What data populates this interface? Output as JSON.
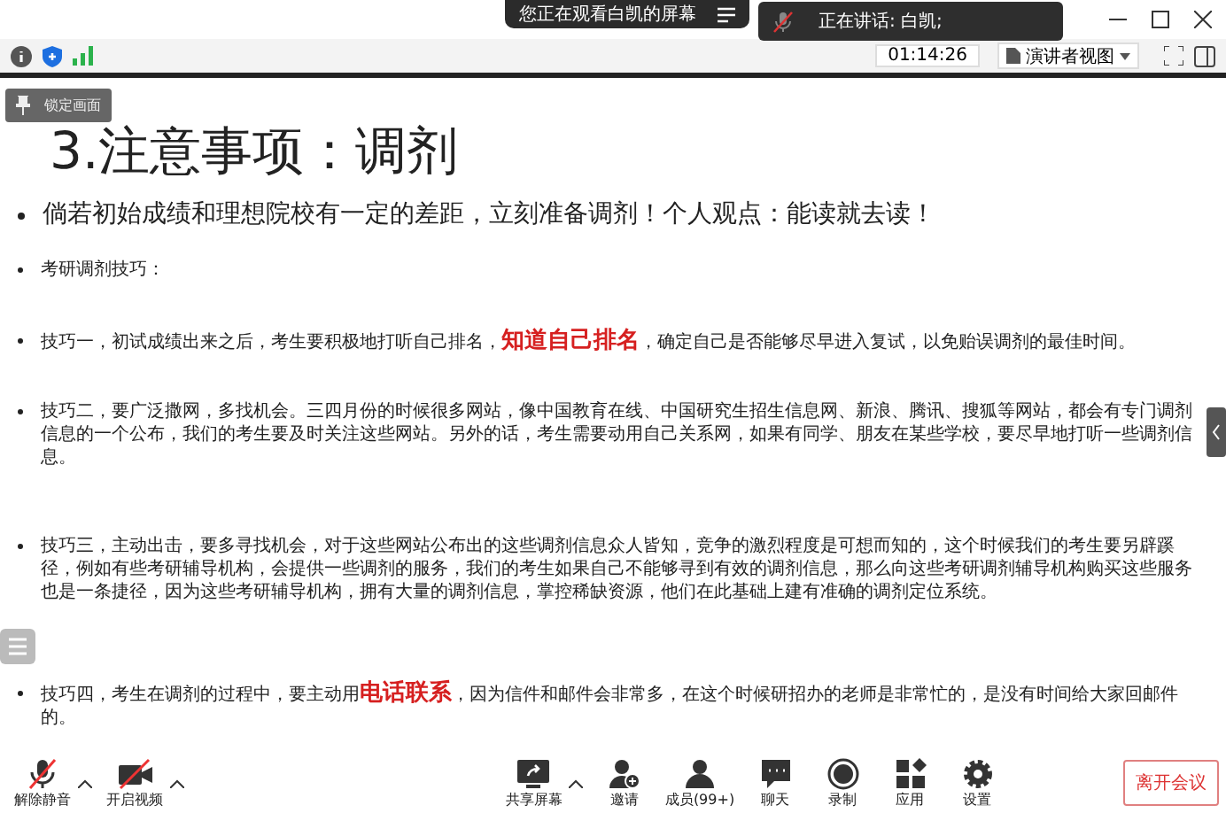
{
  "banner": {
    "text": "您正在观看白凯的屏幕"
  },
  "speaking": {
    "text": "正在讲话: 白凯;"
  },
  "toolbar": {
    "time": "01:14:26",
    "view_menu": "演讲者视图"
  },
  "lock_button": "锁定画面",
  "slide": {
    "title": "3.注意事项：调剂",
    "lead": "倘若初始成绩和理想院校有一定的差距，立刻准备调剂！个人观点：能读就去读！",
    "items": [
      [
        {
          "kind": "plain",
          "text": "考研调剂技巧："
        }
      ],
      [
        {
          "kind": "plain",
          "text": "技巧一，初试成绩出来之后，考生要积极地打听自己排名，"
        },
        {
          "kind": "highlight",
          "text": "知道自己排名"
        },
        {
          "kind": "plain",
          "text": "，确定自己是否能够尽早进入复试，以免贻误调剂的最佳时间。"
        }
      ],
      [
        {
          "kind": "plain",
          "text": "技巧二，要广泛撒网，多找机会。三四月份的时候很多网站，像中国教育在线、中国研究生招生信息网、新浪、腾讯、搜狐等网站，都会有专门调剂信息的一个公布，我们的考生要及时关注这些网站。另外的话，考生需要动用自己关系网，如果有同学、朋友在某些学校，要尽早地打听一些调剂信息。"
        }
      ],
      [
        {
          "kind": "plain",
          "text": "技巧三，主动出击，要多寻找机会，对于这些网站公布出的这些调剂信息众人皆知，竞争的激烈程度是可想而知的，这个时候我们的考生要另辟蹊径，例如有些考研辅导机构，会提供一些调剂的服务，我们的考生如果自己不能够寻到有效的调剂信息，那么向这些考研调剂辅导机构购买这些服务也是一条捷径，因为这些考研辅导机构，拥有大量的调剂信息，掌控稀缺资源，他们在此基础上建有准确的调剂定位系统。"
        }
      ],
      [
        {
          "kind": "plain",
          "text": "技巧四，考生在调剂的过程中，要主动用"
        },
        {
          "kind": "highlight",
          "text": "电话联系"
        },
        {
          "kind": "plain",
          "text": "，因为信件和邮件会非常多，在这个时候研招办的老师是非常忙的，是没有时间给大家回邮件的。"
        }
      ]
    ]
  },
  "controls": [
    {
      "kind": "mic",
      "label": "解除静音",
      "caret": true
    },
    {
      "kind": "video",
      "label": "开启视频",
      "caret": true
    },
    {
      "kind": "share",
      "label": "共享屏幕",
      "caret": true
    },
    {
      "kind": "invite",
      "label": "邀请",
      "caret": false
    },
    {
      "kind": "members",
      "label": "成员(99+)",
      "caret": false
    },
    {
      "kind": "chat",
      "label": "聊天",
      "caret": false
    },
    {
      "kind": "record",
      "label": "录制",
      "caret": false
    },
    {
      "kind": "apps",
      "label": "应用",
      "caret": false
    },
    {
      "kind": "settings",
      "label": "设置",
      "caret": false
    }
  ],
  "leave_button": "离开会议"
}
